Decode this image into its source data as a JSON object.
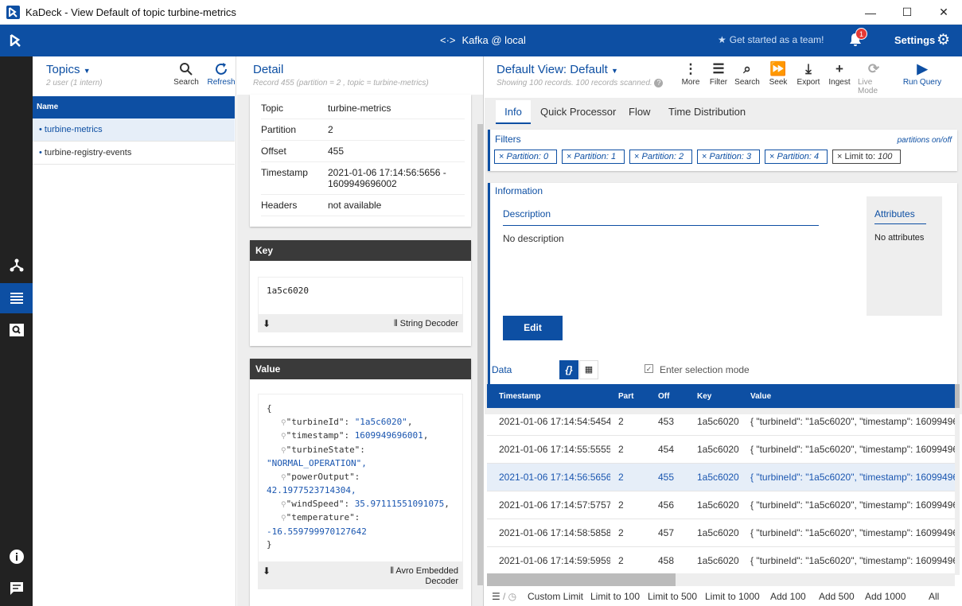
{
  "window": {
    "title": "KaDeck - View Default of topic turbine-metrics"
  },
  "header": {
    "connection": "Kafka @ local",
    "team": "Get started as a team!",
    "notif_count": "1",
    "settings": "Settings"
  },
  "topics": {
    "title": "Topics",
    "subtitle": "2 user (1 intern)",
    "search": "Search",
    "refresh": "Refresh",
    "col_name": "Name",
    "items": [
      {
        "label": "turbine-metrics"
      },
      {
        "label": "turbine-registry-events"
      }
    ]
  },
  "detail": {
    "title": "Detail",
    "subtitle": "Record 455 (partition = 2 , topic = turbine-metrics)",
    "rows": [
      {
        "k": "Topic",
        "v": "turbine-metrics"
      },
      {
        "k": "Partition",
        "v": "2"
      },
      {
        "k": "Offset",
        "v": "455"
      },
      {
        "k": "Timestamp",
        "v": "2021-01-06 17:14:56:5656 - 1609949696002"
      },
      {
        "k": "Headers",
        "v": "not available"
      }
    ],
    "key_title": "Key",
    "key_value": "1a5c6020",
    "key_decoder": "String Decoder",
    "value_title": "Value",
    "value_decoder": "Avro Embedded Decoder",
    "value_lines": [
      {
        "t": "{"
      },
      {
        "k": "\"turbineId\": ",
        "v": "\"1a5c6020\"",
        "e": ","
      },
      {
        "k": "\"timestamp\": ",
        "v": "1609949696001",
        "e": ","
      },
      {
        "k": "\"turbineState\":",
        "v": "",
        "e": ""
      },
      {
        "t": "\"NORMAL_OPERATION\",",
        "blue": true
      },
      {
        "k": "\"powerOutput\":",
        "v": "",
        "e": ""
      },
      {
        "t": "42.1977523714304,",
        "blue": true
      },
      {
        "k": "\"windSpeed\": ",
        "v": "35.97111551091075",
        "e": ","
      },
      {
        "k": "\"temperature\":",
        "v": "",
        "e": ""
      },
      {
        "t": "-16.559799970127642",
        "blue": true
      },
      {
        "t": "}"
      }
    ]
  },
  "view": {
    "title": "Default View: Default",
    "subtitle": "Showing 100 records. 100 records scanned.",
    "toolbar": [
      {
        "label": "More"
      },
      {
        "label": "Filter"
      },
      {
        "label": "Search"
      },
      {
        "label": "Seek"
      },
      {
        "label": "Export"
      },
      {
        "label": "Ingest"
      },
      {
        "label": "Live Mode"
      },
      {
        "label": "Run Query"
      }
    ],
    "tabs": [
      "Info",
      "Quick Processor",
      "Flow",
      "Time Distribution"
    ],
    "filters": {
      "title": "Filters",
      "toggle": "partitions on/off",
      "chips": [
        "Partition: 0",
        "Partition: 1",
        "Partition: 2",
        "Partition: 3",
        "Partition: 4"
      ],
      "limit_label": "Limit to: ",
      "limit_value": "100"
    },
    "info": {
      "title": "Information",
      "desc_title": "Description",
      "desc": "No description",
      "attr_title": "Attributes",
      "attr": "No attributes",
      "edit": "Edit"
    },
    "data": {
      "label": "Data",
      "selection": "Enter selection mode",
      "columns": [
        "Timestamp",
        "Part",
        "Off",
        "Key",
        "Value"
      ],
      "rows": [
        {
          "ts": "2021-01-06 17:14:54:5454",
          "part": "2",
          "off": "453",
          "key": "1a5c6020",
          "val": "{ \"turbineId\": \"1a5c6020\", \"timestamp\": 16099496"
        },
        {
          "ts": "2021-01-06 17:14:55:5555",
          "part": "2",
          "off": "454",
          "key": "1a5c6020",
          "val": "{ \"turbineId\": \"1a5c6020\", \"timestamp\": 16099496"
        },
        {
          "ts": "2021-01-06 17:14:56:5656",
          "part": "2",
          "off": "455",
          "key": "1a5c6020",
          "val": "{ \"turbineId\": \"1a5c6020\", \"timestamp\": 16099496"
        },
        {
          "ts": "2021-01-06 17:14:57:5757",
          "part": "2",
          "off": "456",
          "key": "1a5c6020",
          "val": "{ \"turbineId\": \"1a5c6020\", \"timestamp\": 16099496"
        },
        {
          "ts": "2021-01-06 17:14:58:5858",
          "part": "2",
          "off": "457",
          "key": "1a5c6020",
          "val": "{ \"turbineId\": \"1a5c6020\", \"timestamp\": 16099496"
        },
        {
          "ts": "2021-01-06 17:14:59:5959",
          "part": "2",
          "off": "458",
          "key": "1a5c6020",
          "val": "{ \"turbineId\": \"1a5c6020\", \"timestamp\": 16099496"
        }
      ],
      "selected_index": 2,
      "footer": [
        "Custom Limit",
        "Limit to 100",
        "Limit to 500",
        "Limit to 1000",
        "Add 100",
        "Add 500",
        "Add 1000",
        "All"
      ]
    }
  },
  "colors": {
    "brand": "#0d4fa3",
    "rail": "#222222",
    "selected_row": "#e6eef8"
  }
}
